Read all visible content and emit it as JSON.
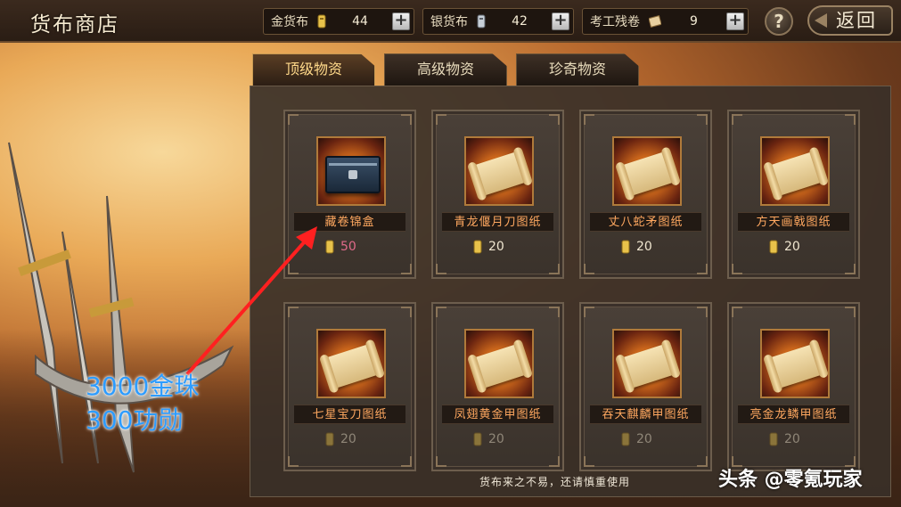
{
  "header": {
    "title": "货布商店",
    "currencies": [
      {
        "label": "金货布",
        "value": "44",
        "icon": "gold-coin-icon",
        "color": "#e8c24a"
      },
      {
        "label": "银货布",
        "value": "42",
        "icon": "silver-coin-icon",
        "color": "#c8d0d8"
      },
      {
        "label": "考工残卷",
        "value": "9",
        "icon": "scroll-fragment-icon",
        "color": "#e8d0a0"
      }
    ],
    "plus_label": "+",
    "help_label": "?",
    "back_label": "返回"
  },
  "tabs": [
    {
      "label": "顶级物资",
      "active": true
    },
    {
      "label": "高级物资",
      "active": false
    },
    {
      "label": "珍奇物资",
      "active": false
    }
  ],
  "items": [
    {
      "name": "藏卷锦盒",
      "price": "50",
      "image": "chest-icon",
      "highlight": true
    },
    {
      "name": "青龙偃月刀图纸",
      "price": "20",
      "image": "scroll-icon"
    },
    {
      "name": "丈八蛇矛图纸",
      "price": "20",
      "image": "scroll-icon"
    },
    {
      "name": "方天画戟图纸",
      "price": "20",
      "image": "scroll-icon"
    },
    {
      "name": "七星宝刀图纸",
      "price": "20",
      "image": "scroll-icon"
    },
    {
      "name": "凤翅黄金甲图纸",
      "price": "20",
      "image": "scroll-icon"
    },
    {
      "name": "吞天麒麟甲图纸",
      "price": "20",
      "image": "scroll-icon"
    },
    {
      "name": "亮金龙鳞甲图纸",
      "price": "20",
      "image": "scroll-icon"
    }
  ],
  "notice": "货布来之不易，还请慎重使用",
  "annotation": {
    "line1": "3000金珠",
    "line2": "300功勋",
    "color": "#2d9cff"
  },
  "watermark": "头条 @零氪玩家"
}
